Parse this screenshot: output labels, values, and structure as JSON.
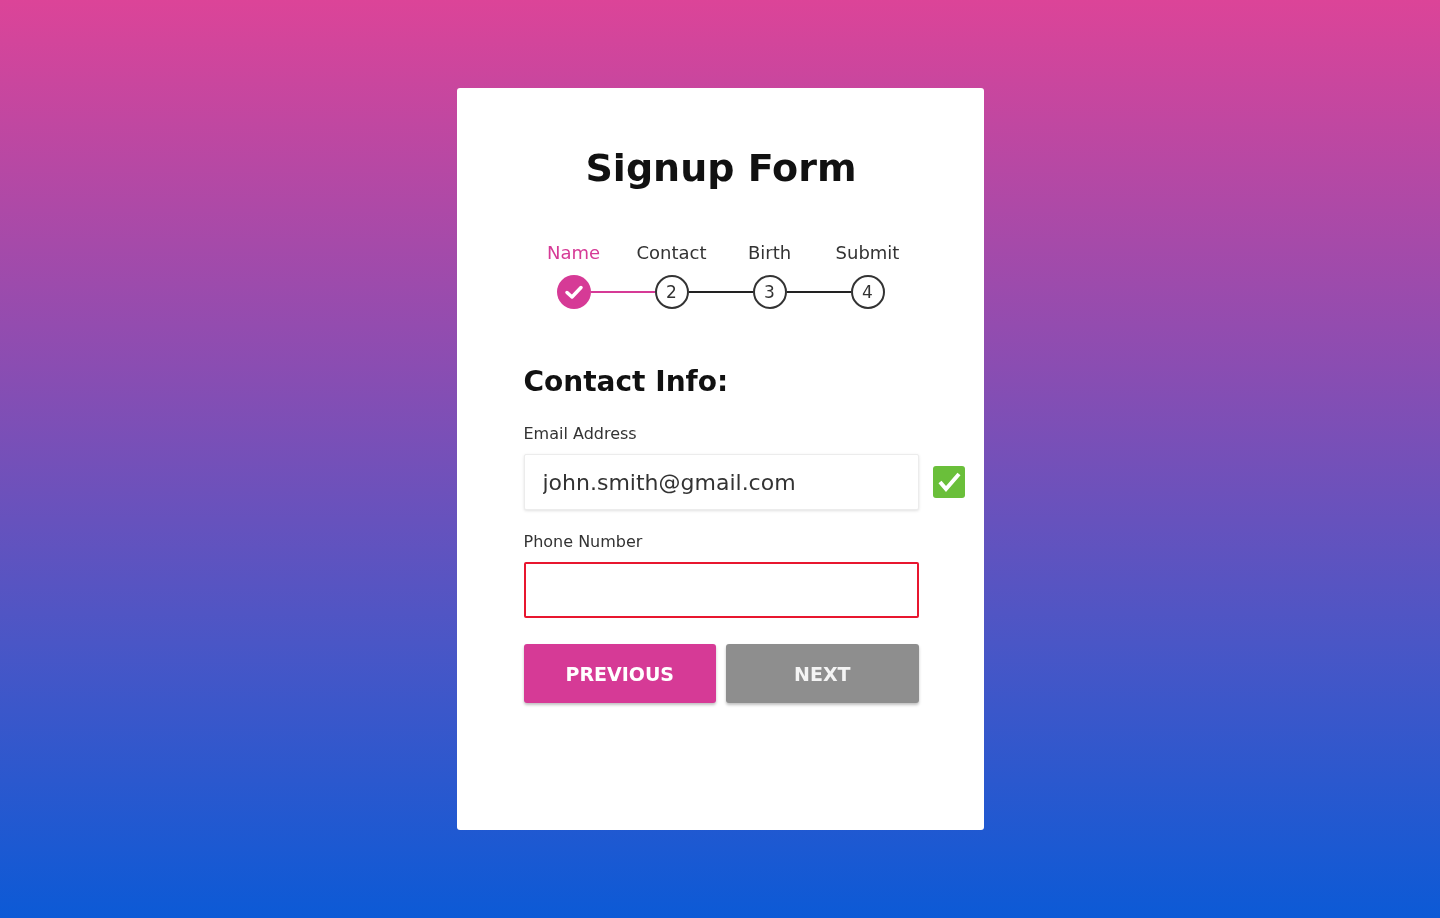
{
  "form": {
    "title": "Signup Form",
    "steps": [
      {
        "label": "Name",
        "done": true
      },
      {
        "label": "Contact",
        "number": "2",
        "done": false
      },
      {
        "label": "Birth",
        "number": "3",
        "done": false
      },
      {
        "label": "Submit",
        "number": "4",
        "done": false
      }
    ],
    "section_title": "Contact Info:",
    "fields": [
      {
        "label": "Email Address",
        "value": "john.smith@gmail.com",
        "valid": true,
        "invalid": false
      },
      {
        "label": "Phone Number",
        "valid": false,
        "invalid": true
      }
    ],
    "buttons": [
      {
        "label": "PREVIOUS",
        "kind": "primary",
        "disabled": false
      },
      {
        "label": "NEXT",
        "kind": "secondary",
        "disabled": true
      }
    ]
  }
}
